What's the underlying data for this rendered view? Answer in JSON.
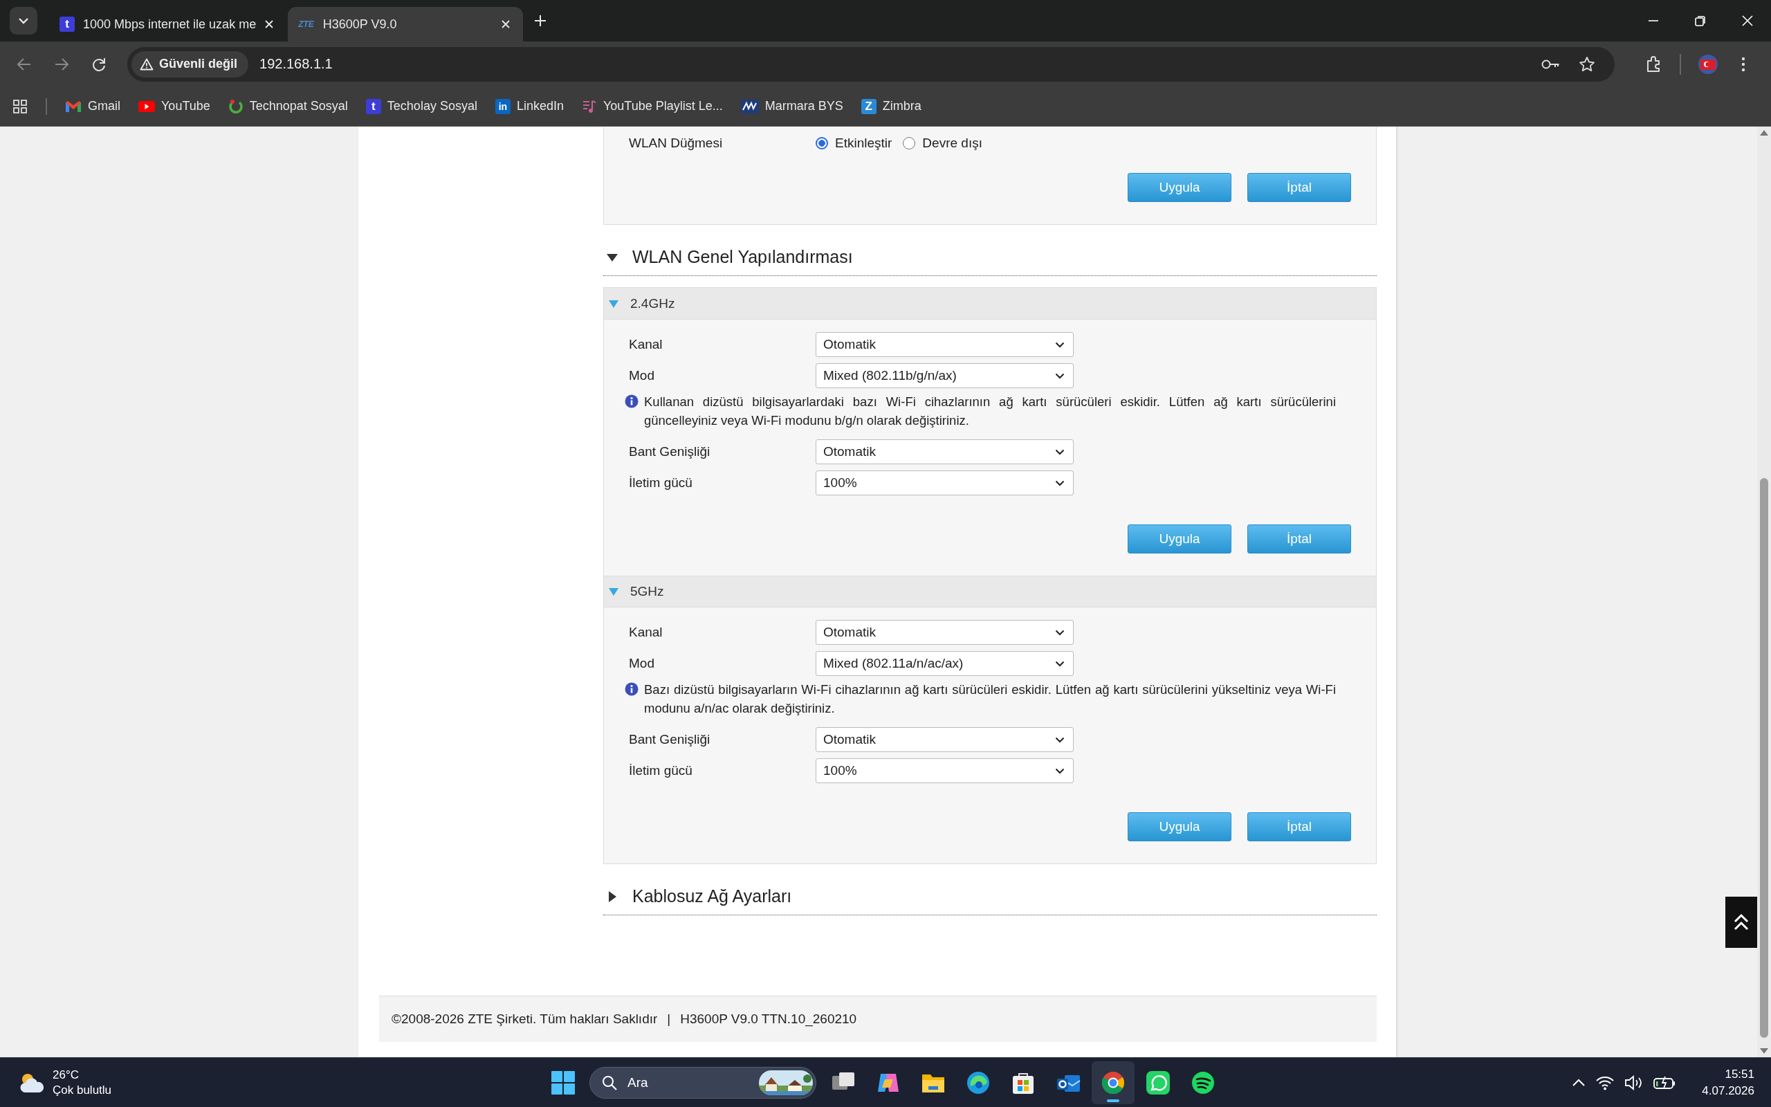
{
  "browser": {
    "tabs": [
      {
        "title": "1000 Mbps internet ile uzak me",
        "kind": "techolay",
        "icon_text": "t",
        "selected": false
      },
      {
        "title": "H3600P V9.0",
        "kind": "zte",
        "icon_text": "ZTE",
        "selected": true
      }
    ],
    "security": "Güvenli değil",
    "url": "192.168.1.1",
    "bookmarks": [
      {
        "label": "Gmail",
        "kind": "gmail"
      },
      {
        "label": "YouTube",
        "kind": "youtube"
      },
      {
        "label": "Technopat Sosyal",
        "kind": "technopat"
      },
      {
        "label": "Techolay Sosyal",
        "kind": "techolay",
        "icon_text": "t"
      },
      {
        "label": "LinkedIn",
        "kind": "linkedin",
        "icon_text": "in"
      },
      {
        "label": "YouTube Playlist Le...",
        "kind": "playlist"
      },
      {
        "label": "Marmara BYS",
        "kind": "marmara"
      },
      {
        "label": "Zimbra",
        "kind": "zimbra",
        "icon_text": "Z"
      }
    ]
  },
  "wlan_switch": {
    "label": "WLAN Düğmesi",
    "options": [
      {
        "label": "Etkinleştir",
        "selected": true
      },
      {
        "label": "Devre dışı",
        "selected": false
      }
    ],
    "buttons": [
      "Uygula",
      "İptal"
    ]
  },
  "sections": [
    {
      "title": "WLAN Genel Yapılandırması",
      "expanded": true,
      "bands": [
        {
          "title": "2.4GHz",
          "expanded": true,
          "fields": [
            {
              "label": "Kanal",
              "value": "Otomatik"
            },
            {
              "label": "Mod",
              "value": "Mixed (802.11b/g/n/ax)",
              "note": "Kullanan dizüstü bilgisayarlardaki bazı Wi-Fi cihazlarının ağ kartı sürücüleri eskidir. Lütfen ağ kartı sürücülerini güncelleyiniz veya Wi-Fi modunu b/g/n olarak değiştiriniz."
            },
            {
              "label": "Bant Genişliği",
              "value": "Otomatik"
            },
            {
              "label": "İletim gücü",
              "value": "100%"
            }
          ],
          "buttons": [
            "Uygula",
            "İptal"
          ]
        },
        {
          "title": "5GHz",
          "expanded": true,
          "fields": [
            {
              "label": "Kanal",
              "value": "Otomatik"
            },
            {
              "label": "Mod",
              "value": "Mixed (802.11a/n/ac/ax)",
              "note": "Bazı dizüstü bilgisayarların Wi-Fi cihazlarının ağ kartı sürücüleri eskidir. Lütfen ağ kartı sürücülerini yükseltiniz veya Wi-Fi modunu a/n/ac olarak değiştiriniz."
            },
            {
              "label": "Bant Genişliği",
              "value": "Otomatik"
            },
            {
              "label": "İletim gücü",
              "value": "100%"
            }
          ],
          "buttons": [
            "Uygula",
            "İptal"
          ]
        }
      ]
    },
    {
      "title": "Kablosuz Ağ Ayarları",
      "expanded": false
    }
  ],
  "footer": {
    "copyright": "©2008-2026 ZTE Şirketi. Tüm hakları Saklıdır",
    "separator": "|",
    "version": "H3600P V9.0 TTN.10_260210"
  },
  "taskbar": {
    "weather": {
      "temperature": "26°C",
      "condition": "Çok bulutlu"
    },
    "search_placeholder": "Ara",
    "apps": [
      {
        "kind": "taskview",
        "selected": false
      },
      {
        "kind": "copilot",
        "selected": false
      },
      {
        "kind": "files",
        "selected": false
      },
      {
        "kind": "edge",
        "selected": false
      },
      {
        "kind": "store",
        "selected": false
      },
      {
        "kind": "outlook",
        "selected": false
      },
      {
        "kind": "chrome",
        "selected": true
      },
      {
        "kind": "whatsapp",
        "selected": false
      },
      {
        "kind": "spotify",
        "selected": false
      }
    ],
    "time": "15:51",
    "date": "4.07.2026"
  }
}
